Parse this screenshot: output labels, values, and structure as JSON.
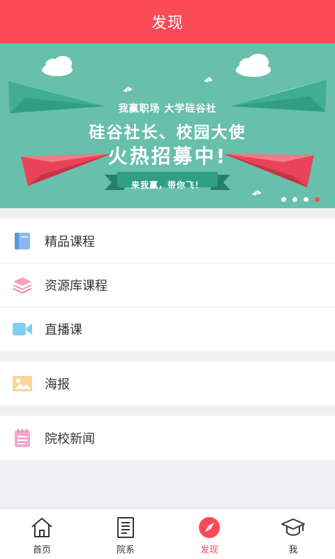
{
  "header": {
    "title": "发现"
  },
  "banner": {
    "line1": "我赢职场  大学硅谷社",
    "line2": "硅谷社长、校园大使",
    "line3": "火热招募中!",
    "ribbon": "来我赢，带你飞！",
    "slide_count": 4,
    "active_slide": 4,
    "colors": {
      "background": "#68bfab",
      "plane_green": "#3fae93",
      "plane_red": "#e8435a",
      "ribbon": "#2f9e85"
    }
  },
  "groups": [
    {
      "items": [
        {
          "label": "精品课程",
          "icon": "book-icon"
        },
        {
          "label": "资源库课程",
          "icon": "layers-icon"
        },
        {
          "label": "直播课",
          "icon": "video-camera-icon"
        }
      ]
    },
    {
      "items": [
        {
          "label": "海报",
          "icon": "image-icon"
        }
      ]
    },
    {
      "items": [
        {
          "label": "院校新闻",
          "icon": "notepad-icon"
        }
      ]
    }
  ],
  "tabs": [
    {
      "label": "首页",
      "icon": "home-icon",
      "active": false
    },
    {
      "label": "院系",
      "icon": "document-list-icon",
      "active": false
    },
    {
      "label": "发现",
      "icon": "compass-icon",
      "active": true
    },
    {
      "label": "我",
      "icon": "graduation-cap-icon",
      "active": false
    }
  ],
  "colors": {
    "accent": "#fa4a58",
    "text": "#333333",
    "background": "#f0f0f4"
  }
}
